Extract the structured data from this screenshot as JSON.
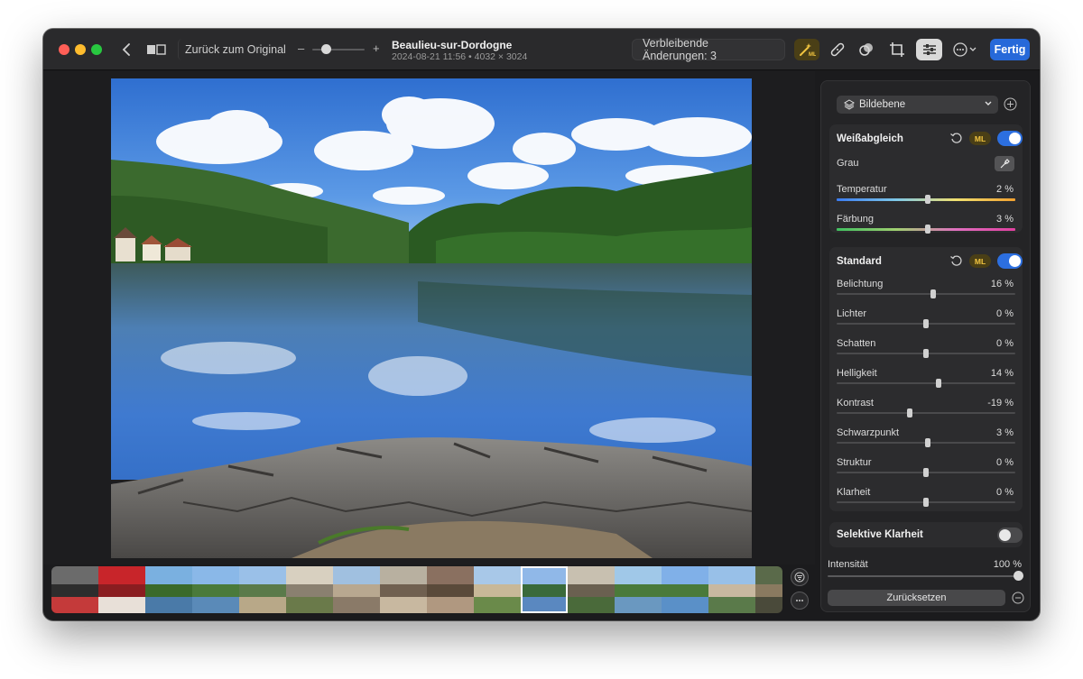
{
  "toolbar": {
    "revert_label": "Zurück zum Original",
    "zoom_minus": "–",
    "zoom_plus": "+",
    "zoom_level": 0.25,
    "title": "Beaulieu-sur-Dordogne",
    "subtitle": "2024-08-21 11:56 • 4032 × 3024",
    "remaining_label": "Verbleibende Änderungen: 3",
    "done_label": "Fertig",
    "tools": [
      "magic-wand-ml-icon",
      "bandaid-icon",
      "circles-icon",
      "crop-icon",
      "adjust-sliders-icon",
      "more-icon"
    ]
  },
  "sidebar": {
    "layer": {
      "label": "Bildebene"
    },
    "white_balance": {
      "title": "Weißabgleich",
      "ml_badge": "ML",
      "enabled": true,
      "gray_label": "Grau",
      "rows": [
        {
          "label": "Temperatur",
          "value": "2 %",
          "level": 0.51
        },
        {
          "label": "Färbung",
          "value": "3 %",
          "level": 0.51
        }
      ]
    },
    "standard": {
      "title": "Standard",
      "ml_badge": "ML",
      "enabled": true,
      "rows": [
        {
          "label": "Belichtung",
          "value": "16 %",
          "level": 0.54
        },
        {
          "label": "Lichter",
          "value": "0 %",
          "level": 0.5
        },
        {
          "label": "Schatten",
          "value": "0 %",
          "level": 0.5
        },
        {
          "label": "Helligkeit",
          "value": "14 %",
          "level": 0.57
        },
        {
          "label": "Kontrast",
          "value": "-19 %",
          "level": 0.41
        },
        {
          "label": "Schwarzpunkt",
          "value": "3 %",
          "level": 0.51
        },
        {
          "label": "Struktur",
          "value": "0 %",
          "level": 0.5
        },
        {
          "label": "Klarheit",
          "value": "0 %",
          "level": 0.5
        }
      ]
    },
    "selective_clarity": {
      "title": "Selektive Klarheit",
      "enabled": false
    },
    "intensity": {
      "label": "Intensität",
      "value": "100 %",
      "level": 1.0
    },
    "reset_label": "Zurücksetzen"
  },
  "filmstrip": {
    "selected_index": 10,
    "count": 16
  },
  "colors": {
    "accent": "#2769d9",
    "ml_badge": "#f2c540",
    "toggle_on": "#2c6fe0"
  }
}
